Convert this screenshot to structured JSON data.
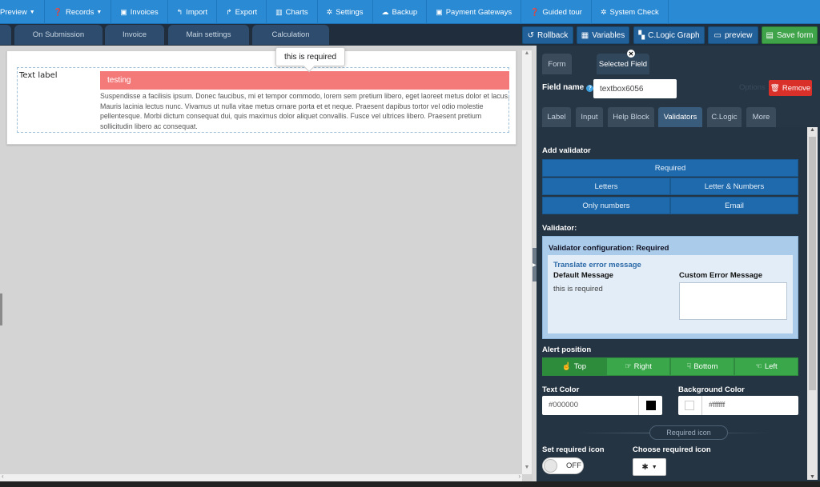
{
  "topbar": {
    "items": [
      {
        "label": "Preview",
        "icon": "eye-icon",
        "caret": true
      },
      {
        "label": "Records",
        "icon": "question-icon",
        "caret": true
      },
      {
        "label": "Invoices",
        "icon": "money-icon",
        "caret": false
      },
      {
        "label": "Import",
        "icon": "reply-icon",
        "caret": false
      },
      {
        "label": "Export",
        "icon": "share-icon",
        "caret": false
      },
      {
        "label": "Charts",
        "icon": "chart-icon",
        "caret": false
      },
      {
        "label": "Settings",
        "icon": "gear-icon",
        "caret": false
      },
      {
        "label": "Backup",
        "icon": "cloud-upload-icon",
        "caret": false
      },
      {
        "label": "Payment Gateways",
        "icon": "money-icon",
        "caret": false
      },
      {
        "label": "Guided tour",
        "icon": "question-icon",
        "caret": false
      },
      {
        "label": "System Check",
        "icon": "gear-icon",
        "caret": false
      }
    ]
  },
  "tabs": {
    "on_submission": "On Submission",
    "invoice": "Invoice",
    "main_settings": "Main settings",
    "calculation": "Calculation"
  },
  "toolbar": {
    "rollback": "Rollback",
    "variables": "Variables",
    "clogic_graph": "C.Logic Graph",
    "preview": "preview",
    "save_form": "Save form"
  },
  "canvas": {
    "field_label": "Text label",
    "field_value": "testing",
    "help_text": "Suspendisse a facilisis ipsum. Donec faucibus, mi et tempor commodo, lorem sem pretium libero, eget laoreet metus dolor et lacus. Mauris lacinia lectus nunc. Vivamus ut nulla vitae metus ornare porta et et neque. Praesent dapibus tortor vel odio molestie pellentesque. Morbi dictum consequat dui, quis maximus dolor aliquet convallis. Fusce vel ultrices libero. Praesent pretium sollicitudin libero ac consequat.",
    "tooltip": "this is required"
  },
  "panel": {
    "tab_form": "Form",
    "tab_selected": "Selected Field",
    "field_name_label": "Field name",
    "field_name_value": "textbox6056",
    "options_label": "Options",
    "remove_label": "Remove",
    "subtabs": [
      "Label",
      "Input",
      "Help Block",
      "Validators",
      "C.Logic",
      "More"
    ],
    "active_subtab": "Validators",
    "add_validator_label": "Add validator",
    "validators": {
      "required": "Required",
      "letters": "Letters",
      "letters_numbers": "Letter & Numbers",
      "only_numbers": "Only numbers",
      "email": "Email"
    },
    "validator_label": "Validator:",
    "validator_config_title": "Validator configuration: Required",
    "translate_label": "Translate error message",
    "default_message_label": "Default Message",
    "default_message": "this is required",
    "custom_error_label": "Custom Error Message",
    "alert_position_label": "Alert position",
    "alert_positions": [
      "Top",
      "Right",
      "Bottom",
      "Left"
    ],
    "alert_selected": "Top",
    "text_color_label": "Text Color",
    "text_color_value": "#000000",
    "bg_color_label": "Background Color",
    "bg_color_value": "#ffffff",
    "required_icon_divider": "Required icon",
    "set_required_icon_label": "Set required icon",
    "toggle_state": "OFF",
    "choose_required_icon_label": "Choose required icon",
    "chosen_icon": "✱"
  },
  "colors": {
    "topbar": "#2a8ad4",
    "panel_bg": "#263645",
    "error_field": "#f47a7a",
    "validator_button": "#1f6aad",
    "alert_button": "#3aa84a",
    "remove_button": "#d9302a"
  }
}
